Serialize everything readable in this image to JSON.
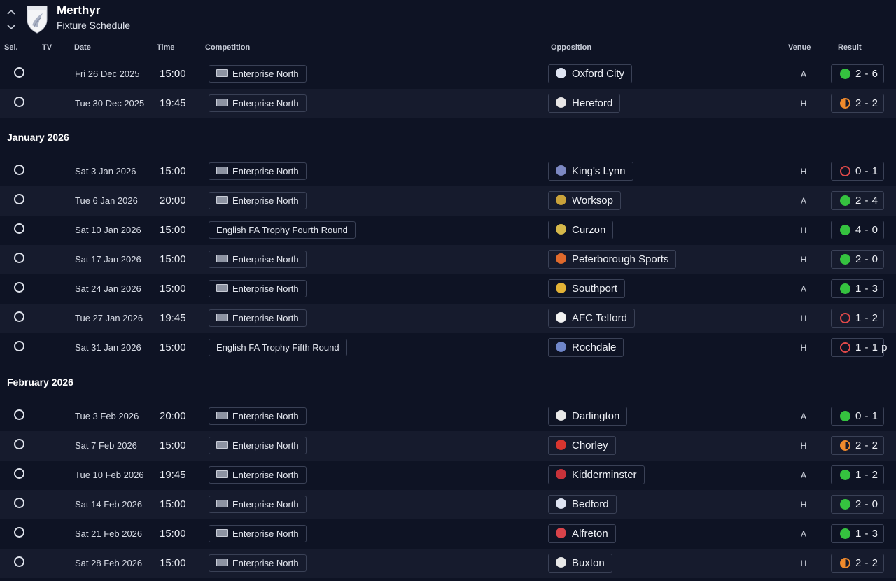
{
  "header": {
    "club_name": "Merthyr",
    "subtitle": "Fixture Schedule",
    "nav_up_icon": "chevron-up-icon",
    "nav_down_icon": "chevron-down-icon"
  },
  "columns": {
    "sel": "Sel.",
    "tv": "TV",
    "date": "Date",
    "time": "Time",
    "competition": "Competition",
    "opposition": "Opposition",
    "venue": "Venue",
    "result": "Result"
  },
  "colors": {
    "win": "#35c23f",
    "draw": "#f08a2c",
    "loss": "#e14a4a",
    "background": "#0e1324",
    "row_alt": "#161b2d"
  },
  "groups": [
    {
      "month": "",
      "fixtures": [
        {
          "date": "Fri 26 Dec 2025",
          "time": "15:00",
          "competition": "Enterprise North",
          "comp_flag": true,
          "opponent": "Oxford City",
          "badge_color": "#dfe4f2",
          "venue": "A",
          "outcome": "win",
          "score": "2 - 6"
        },
        {
          "date": "Tue 30 Dec 2025",
          "time": "19:45",
          "competition": "Enterprise North",
          "comp_flag": true,
          "opponent": "Hereford",
          "badge_color": "#e8e6e6",
          "venue": "H",
          "outcome": "draw",
          "score": "2 - 2"
        }
      ]
    },
    {
      "month": "January 2026",
      "fixtures": [
        {
          "date": "Sat 3 Jan 2026",
          "time": "15:00",
          "competition": "Enterprise North",
          "comp_flag": true,
          "opponent": "King's Lynn",
          "badge_color": "#7c88c2",
          "venue": "H",
          "outcome": "loss",
          "score": "0 - 1"
        },
        {
          "date": "Tue 6 Jan 2026",
          "time": "20:00",
          "competition": "Enterprise North",
          "comp_flag": true,
          "opponent": "Worksop",
          "badge_color": "#c9a23a",
          "venue": "A",
          "outcome": "win",
          "score": "2 - 4"
        },
        {
          "date": "Sat 10 Jan 2026",
          "time": "15:00",
          "competition": "English FA Trophy Fourth Round",
          "comp_flag": false,
          "opponent": "Curzon",
          "badge_color": "#d6b84a",
          "venue": "H",
          "outcome": "win",
          "score": "4 - 0"
        },
        {
          "date": "Sat 17 Jan 2026",
          "time": "15:00",
          "competition": "Enterprise North",
          "comp_flag": true,
          "opponent": "Peterborough Sports",
          "badge_color": "#e06a2c",
          "venue": "H",
          "outcome": "win",
          "score": "2 - 0"
        },
        {
          "date": "Sat 24 Jan 2026",
          "time": "15:00",
          "competition": "Enterprise North",
          "comp_flag": true,
          "opponent": "Southport",
          "badge_color": "#e2b236",
          "venue": "A",
          "outcome": "win",
          "score": "1 - 3"
        },
        {
          "date": "Tue 27 Jan 2026",
          "time": "19:45",
          "competition": "Enterprise North",
          "comp_flag": true,
          "opponent": "AFC Telford",
          "badge_color": "#f2f2f2",
          "venue": "H",
          "outcome": "loss",
          "score": "1 - 2"
        },
        {
          "date": "Sat 31 Jan 2026",
          "time": "15:00",
          "competition": "English FA Trophy Fifth Round",
          "comp_flag": false,
          "opponent": "Rochdale",
          "badge_color": "#6f86c9",
          "venue": "H",
          "outcome": "loss",
          "score": "1 - 1 p"
        }
      ]
    },
    {
      "month": "February 2026",
      "fixtures": [
        {
          "date": "Tue 3 Feb 2026",
          "time": "20:00",
          "competition": "Enterprise North",
          "comp_flag": true,
          "opponent": "Darlington",
          "badge_color": "#e9e9e9",
          "venue": "A",
          "outcome": "win",
          "score": "0 - 1"
        },
        {
          "date": "Sat 7 Feb 2026",
          "time": "15:00",
          "competition": "Enterprise North",
          "comp_flag": true,
          "opponent": "Chorley",
          "badge_color": "#d8352f",
          "venue": "H",
          "outcome": "draw",
          "score": "2 - 2"
        },
        {
          "date": "Tue 10 Feb 2026",
          "time": "19:45",
          "competition": "Enterprise North",
          "comp_flag": true,
          "opponent": "Kidderminster",
          "badge_color": "#c8323a",
          "venue": "A",
          "outcome": "win",
          "score": "1 - 2"
        },
        {
          "date": "Sat 14 Feb 2026",
          "time": "15:00",
          "competition": "Enterprise North",
          "comp_flag": true,
          "opponent": "Bedford",
          "badge_color": "#dfe4f2",
          "venue": "H",
          "outcome": "win",
          "score": "2 - 0"
        },
        {
          "date": "Sat 21 Feb 2026",
          "time": "15:00",
          "competition": "Enterprise North",
          "comp_flag": true,
          "opponent": "Alfreton",
          "badge_color": "#d9434a",
          "venue": "A",
          "outcome": "win",
          "score": "1 - 3"
        },
        {
          "date": "Sat 28 Feb 2026",
          "time": "15:00",
          "competition": "Enterprise North",
          "comp_flag": true,
          "opponent": "Buxton",
          "badge_color": "#e8e8e8",
          "venue": "H",
          "outcome": "draw",
          "score": "2 - 2"
        }
      ]
    }
  ]
}
